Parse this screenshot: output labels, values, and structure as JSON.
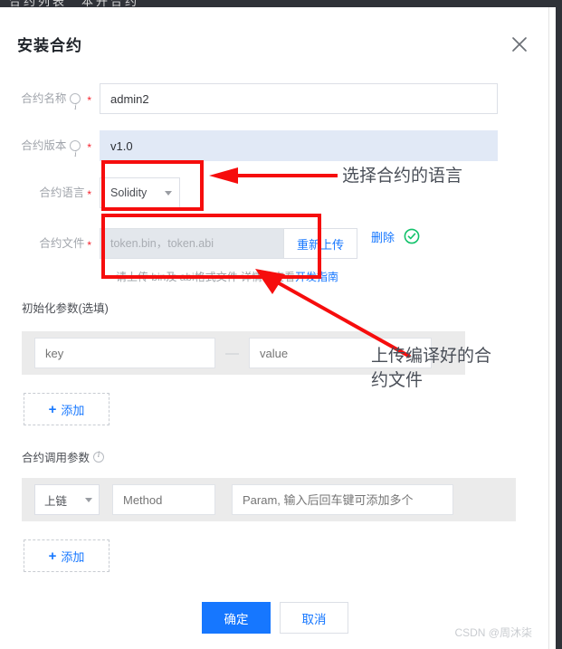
{
  "window": {
    "top_bar_fragment_left": "合约列表",
    "top_bar_fragment_right": "本开合约"
  },
  "dialog": {
    "title": "安装合约",
    "close_icon": "close-icon"
  },
  "form": {
    "contract_name": {
      "label": "合约名称",
      "info_icon": "info-icon",
      "required_mark": "*",
      "value": "admin2"
    },
    "contract_version": {
      "label": "合约版本",
      "info_icon": "info-icon",
      "required_mark": "*",
      "value": "v1.0"
    },
    "contract_language": {
      "label": "合约语言",
      "required_mark": "*",
      "selected": "Solidity",
      "caret_icon": "chevron-down-icon"
    },
    "contract_file": {
      "label": "合约文件",
      "required_mark": "*",
      "filename_placeholder": "token.bin，token.abi",
      "reupload_label": "重新上传",
      "delete_label": "删除",
      "status_icon": "check-circle-icon",
      "helper_prefix": "请上传 bin及 abi格式文件 详情请查看",
      "helper_link": "开发指南"
    }
  },
  "init_params": {
    "title": "初始化参数(选填)",
    "key_placeholder": "key",
    "separator": "—",
    "value_placeholder": "value",
    "add_label": "添加",
    "add_icon": "plus-icon"
  },
  "call_params": {
    "title": "合约调用参数",
    "info_icon": "info-icon",
    "chain_select": "上链",
    "caret_icon": "chevron-down-icon",
    "method_placeholder": "Method",
    "param_placeholder": "Param, 输入后回车键可添加多个",
    "add_label": "添加",
    "add_icon": "plus-icon"
  },
  "footer": {
    "confirm_label": "确定",
    "cancel_label": "取消"
  },
  "watermark": "CSDN @周沐柒",
  "annotations": {
    "language_note": "选择合约的语言",
    "file_note_line1": "上传编译好的合",
    "file_note_line2": "约文件",
    "highlight_color": "#f60d0d"
  }
}
